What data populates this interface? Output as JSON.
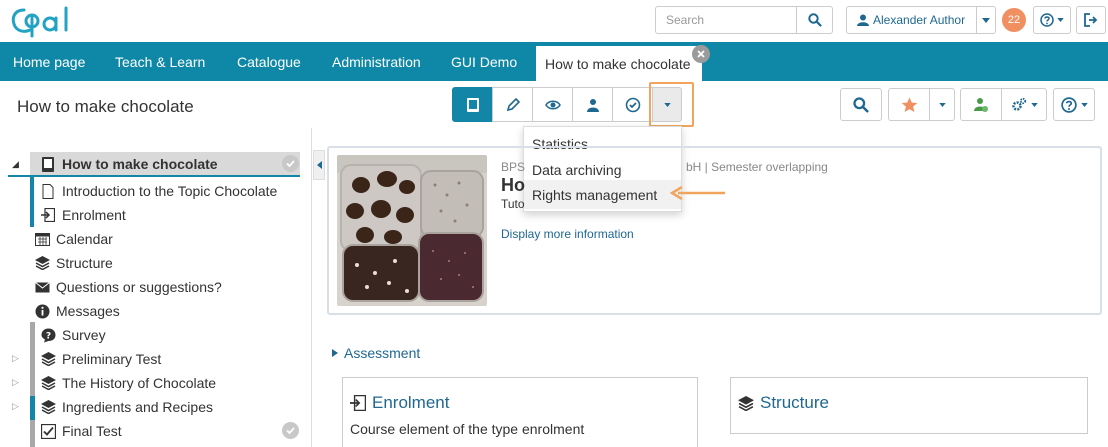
{
  "header": {
    "logo_text": "Opal",
    "search_placeholder": "Search",
    "user_name": "Alexander Author",
    "notifications_count": "22"
  },
  "nav": {
    "items": [
      "Home page",
      "Teach & Learn",
      "Catalogue",
      "Administration",
      "GUI Demo"
    ],
    "active_tab": "How to make chocolate"
  },
  "toolbar": {
    "course_title": "How to make chocolate",
    "dropdown_menu": [
      "Statistics",
      "Data archiving",
      "Rights management"
    ]
  },
  "sidebar": {
    "items": [
      {
        "label": "How to make chocolate",
        "icon": "book-icon"
      },
      {
        "label": "Introduction to the Topic Chocolate",
        "icon": "page-icon"
      },
      {
        "label": "Enrolment",
        "icon": "enrolment-icon"
      },
      {
        "label": "Calendar",
        "icon": "calendar-icon"
      },
      {
        "label": "Structure",
        "icon": "structure-icon"
      },
      {
        "label": "Questions or suggestions?",
        "icon": "envelope-icon"
      },
      {
        "label": "Messages",
        "icon": "info-icon"
      },
      {
        "label": "Survey",
        "icon": "survey-icon"
      },
      {
        "label": "Preliminary Test",
        "icon": "test-icon"
      },
      {
        "label": "The History of Chocolate",
        "icon": "structure-icon"
      },
      {
        "label": "Ingredients and Recipes",
        "icon": "structure-icon"
      },
      {
        "label": "Final Test",
        "icon": "checkbox-icon"
      }
    ]
  },
  "course_info": {
    "meta_left": "BPS",
    "meta_right": "bH | Semester overlapping",
    "title_partial": "Ho",
    "tutor_partial": "Tuto",
    "more_link": "Display more information"
  },
  "content": {
    "section_label": "Assessment",
    "cards": [
      {
        "title": "Enrolment",
        "description": "Course element of the type enrolment"
      },
      {
        "title": "Structure",
        "description": ""
      }
    ]
  },
  "colors": {
    "nav_bg": "#0f88a7",
    "accent": "#1385a6",
    "link": "#1f6891",
    "highlight": "#f0a45c",
    "badge": "#f08f60"
  }
}
